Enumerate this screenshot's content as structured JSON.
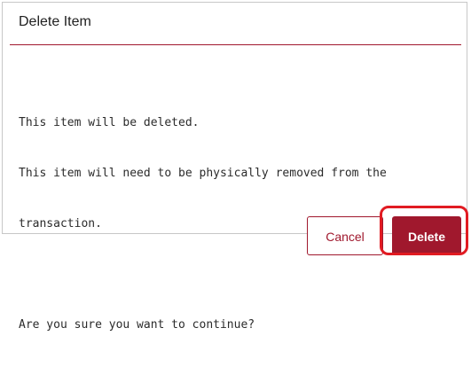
{
  "dialog": {
    "title": "Delete Item",
    "body_lines": [
      "This item will be deleted.",
      "This item will need to be physically removed from the",
      "transaction.",
      "",
      "Are you sure you want to continue?"
    ]
  },
  "buttons": {
    "cancel_label": "Cancel",
    "delete_label": "Delete"
  },
  "colors": {
    "accent": "#a0182d",
    "highlight": "#e11b22"
  }
}
